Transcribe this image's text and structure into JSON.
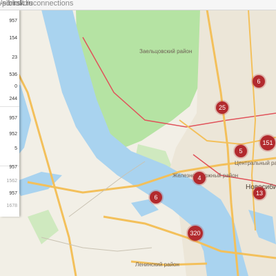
{
  "browser": {
    "url_prefix": "-sibirsk.ru",
    "url_path": "/portal/disconnections"
  },
  "sidebar": {
    "cards": [
      {
        "values": [
          "957",
          "154",
          "23",
          "536",
          "0",
          "244"
        ]
      },
      {
        "values": [
          "957",
          "952",
          "5"
        ]
      },
      {
        "values": [
          "957",
          "1562",
          "957",
          "1678"
        ]
      }
    ]
  },
  "map": {
    "labels": {
      "district_zaeltsovsky": "Заельцовский район",
      "district_centralny": "Центральный район",
      "district_zheleznodorozhny": "Железнодорожный район",
      "district_leninsky": "Ленинский район",
      "city": "Новосиби"
    },
    "markers": [
      {
        "value": "6"
      },
      {
        "value": "25"
      },
      {
        "value": "151"
      },
      {
        "value": "5"
      },
      {
        "value": "4"
      },
      {
        "value": "13"
      },
      {
        "value": "6"
      },
      {
        "value": "320"
      }
    ],
    "colors": {
      "river": "#a9d3ef",
      "forest": "#b5e3a3",
      "land": "#f2efe6",
      "marker": "#b22a2e",
      "road_major": "#f3c05b",
      "road_border": "#e0525a"
    }
  }
}
